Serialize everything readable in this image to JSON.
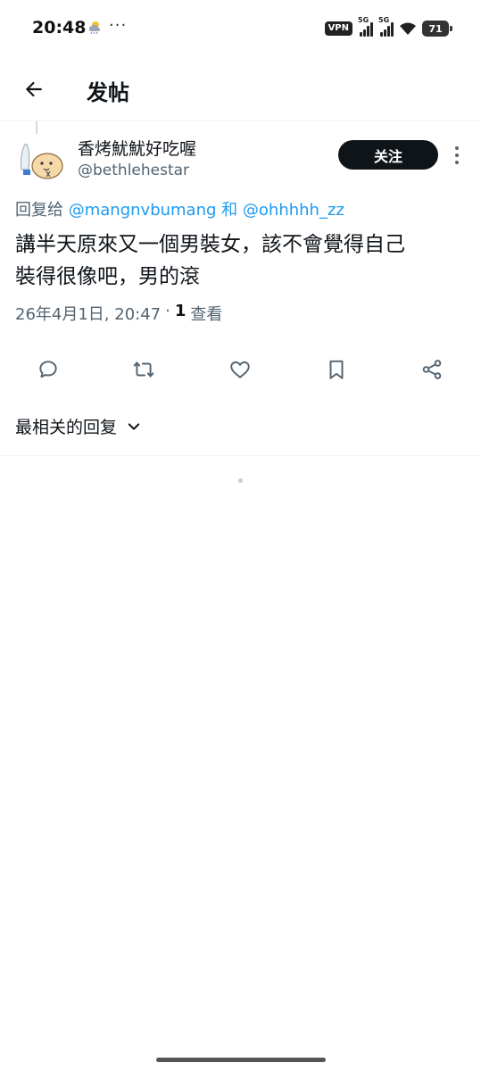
{
  "status_bar": {
    "time": "20:48",
    "dots": "···",
    "vpn": "VPN",
    "sim1": "5G",
    "sim2": "5G",
    "battery": "71"
  },
  "header": {
    "title": "发帖",
    "back_icon": "arrow-left-icon"
  },
  "post": {
    "display_name": "香烤魷魷好吃喔",
    "handle": "@bethlehestar",
    "follow_label": "关注",
    "reply_prefix": "回复给",
    "reply_mention_1": "@mangnvbumang",
    "reply_conj": "和",
    "reply_mention_2": "@ohhhhh_zz",
    "text_line_1": "講半天原來又一個男裝女，該不會覺得自己",
    "text_line_2": "裝得很像吧，男的滾",
    "timestamp": "26年4月1日, 20:47",
    "separator": "·",
    "views_count": "1",
    "views_label": "查看"
  },
  "actions": {
    "reply": "reply-icon",
    "repost": "repost-icon",
    "like": "heart-icon",
    "bookmark": "bookmark-icon",
    "share": "share-icon"
  },
  "replies": {
    "sort_label": "最相关的回复"
  },
  "colors": {
    "accent": "#1d9bf0",
    "text": "#0f1419",
    "muted": "#536471"
  }
}
